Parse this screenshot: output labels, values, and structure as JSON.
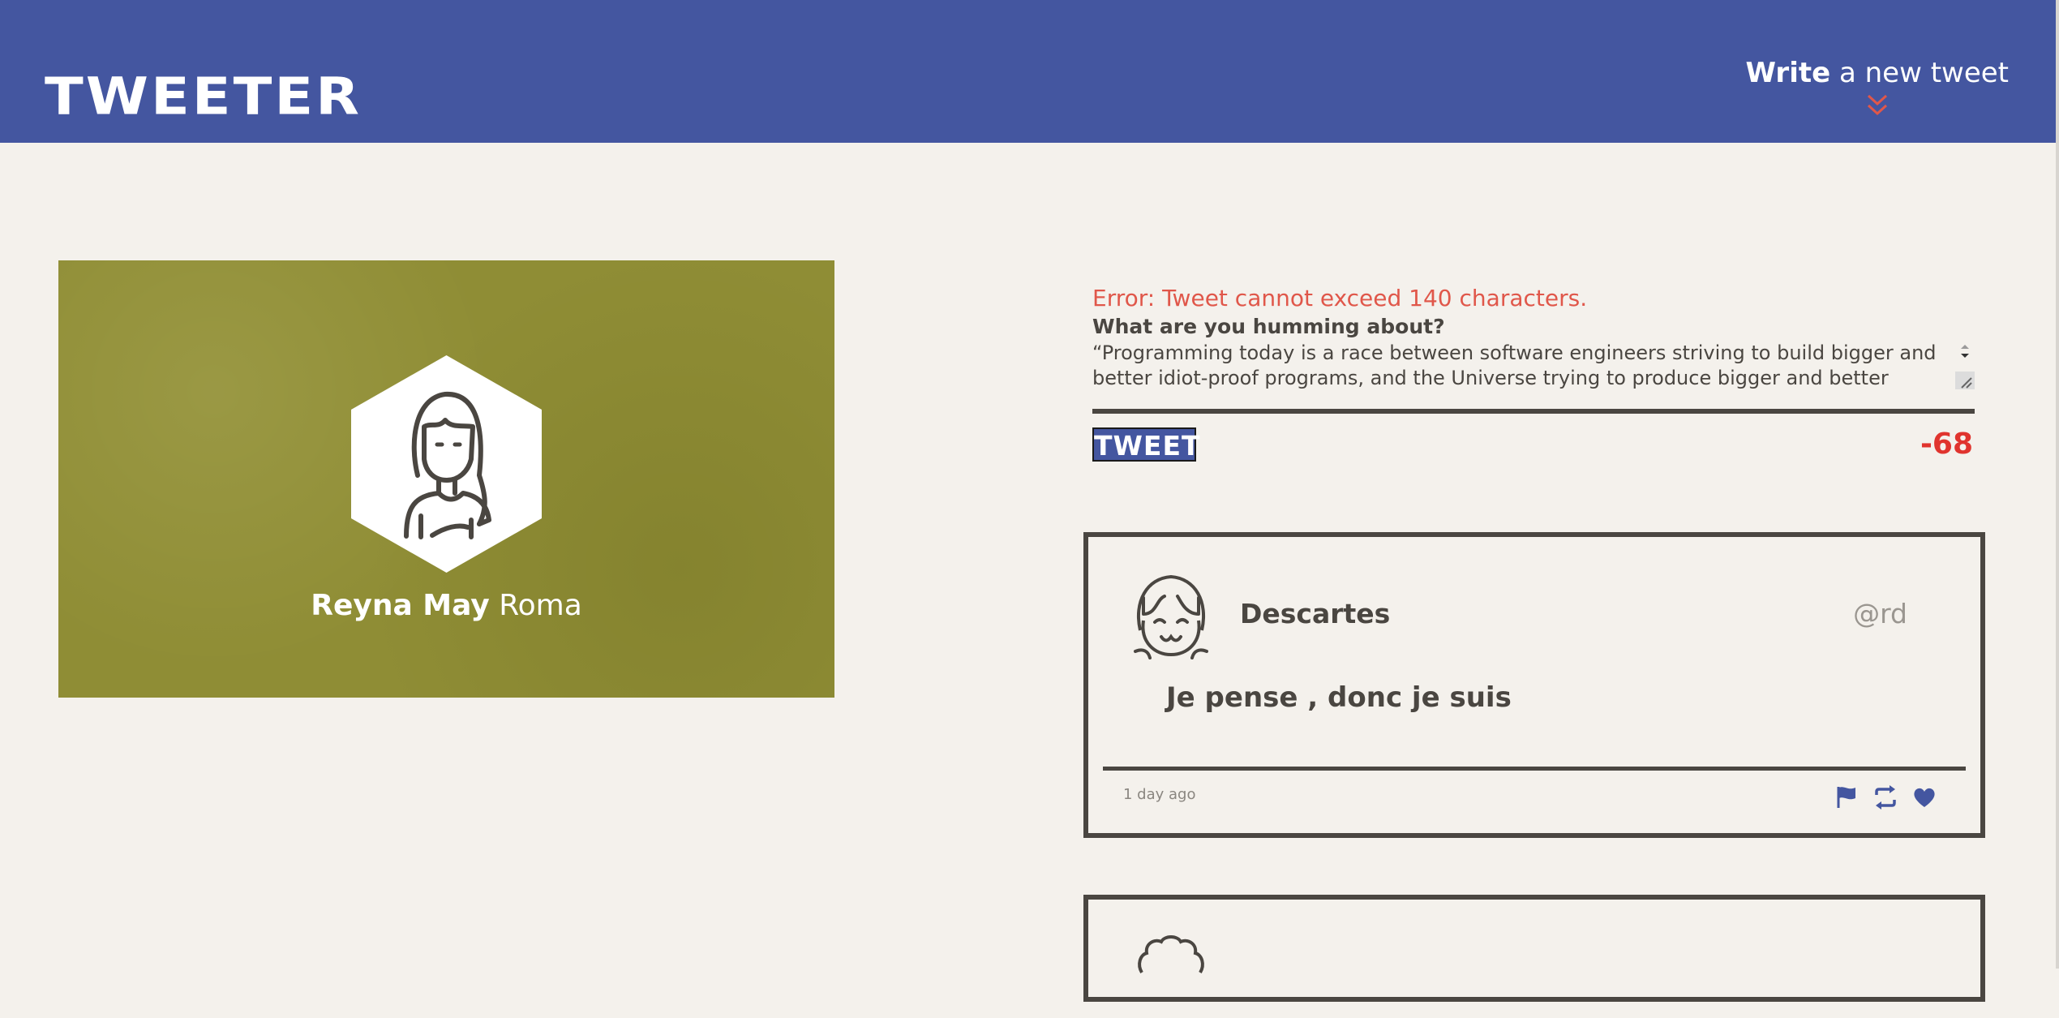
{
  "nav": {
    "brand": "TWEETER",
    "compose_toggle": {
      "bold": "Write",
      "rest": " a new tweet"
    }
  },
  "profile": {
    "first_name": "Reyna May",
    "last_name": "Roma",
    "background_color": "#8f8d35"
  },
  "compose": {
    "error": "Error: Tweet cannot exceed 140 characters.",
    "prompt": "What are you humming about?",
    "text": "“Programming today is a race between software engineers striving to build bigger and better idiot-proof programs, and the Universe trying to produce bigger and better idiots. So far, the Universe is",
    "button_label": "TWEET",
    "counter": "-68"
  },
  "tweets": [
    {
      "name": "Descartes",
      "handle": "@rd",
      "body": "Je pense , donc je suis",
      "time": "1 day ago",
      "actions": [
        "flag-icon",
        "retweet-icon",
        "heart-icon"
      ]
    }
  ],
  "colors": {
    "nav": "#4456a0",
    "background": "#f4f1ec",
    "text": "#4a4641",
    "error": "#e0574a",
    "counter": "#e0342e",
    "chevron": "#e0574a"
  }
}
